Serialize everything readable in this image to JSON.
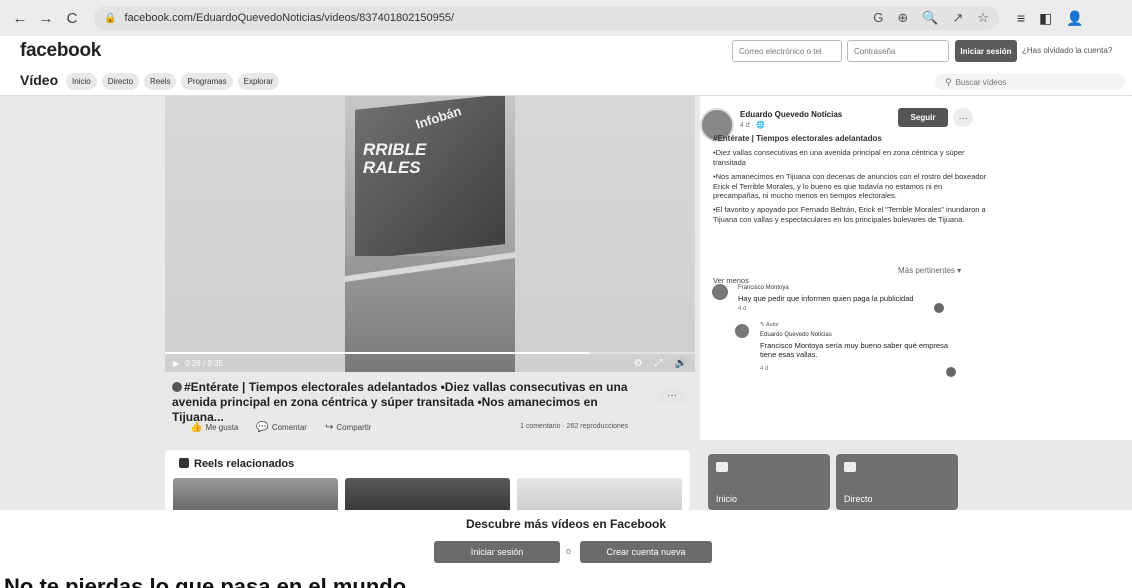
{
  "browser": {
    "url": "facebook.com/EduardoQuevedoNoticias/videos/837401802150955/"
  },
  "header": {
    "logo": "facebook",
    "email_placeholder": "Correo electrónico o tel",
    "password_placeholder": "Contraseña",
    "login_label": "Iniciar sesión",
    "forgot_label": "¿Has olvidado la cuenta?"
  },
  "video_nav": {
    "title": "Vídeo",
    "pills": [
      "Inicio",
      "Directo",
      "Reels",
      "Programas",
      "Explorar"
    ],
    "search_placeholder": "Buscar vídeos"
  },
  "video": {
    "billboard_text": "RRIBLE\nRALES",
    "billboard_brand": "Infobán",
    "time": "0:28 / 0:35",
    "progress": 0.8
  },
  "post": {
    "caption": "#Entérate | Tiempos electorales adelantados •Diez vallas consecutivas en una avenida principal en zona céntrica y súper transitada •Nos amanecimos en Tijuana...",
    "actions": [
      "Me gusta",
      "Comentar",
      "Compartir"
    ],
    "stats": "1 comentario · 262 reproducciones"
  },
  "sidebar": {
    "author": "Eduardo Quevedo Noticias",
    "meta": "4 d · ",
    "follow_label": "Seguir",
    "headline": "#Entérate | Tiempos electorales adelantados",
    "paragraphs": [
      "•Diez vallas consecutivas en una avenida principal en zona céntrica y súper transitada",
      "•Nos amanecimos en Tijuana con decenas de anuncios con el rostro del boxeador Erick el Terrible Morales, y lo bueno es que todavía no estamos ni en precampañas, ni mucho menos en tiempos electorales.",
      "•El favorito y apoyado por Fernado Beltrán, Erick el \"Terrible Morales\" inundaron a Tijuana con vallas y espectaculares en los principales bulevares de Tijuana."
    ],
    "see_less": "Ver menos",
    "relevance": "Más pertinentes ▾",
    "comments": [
      {
        "name": "Francisco Montoya",
        "text": "Hay que pedir que informen quien paga la publicidad",
        "time": "4 d"
      },
      {
        "author_tag": "Autor",
        "name": "Eduardo Quevedo Noticias",
        "text": "Francisco Montoya sería muy bueno saber qué empresa tiene esas vallas.",
        "time": "4 d"
      }
    ]
  },
  "reels": {
    "title": "Reels relacionados"
  },
  "tiles": [
    {
      "label": "Inicio"
    },
    {
      "label": "Directo"
    }
  ],
  "cta": {
    "text": "Descubre más vídeos en Facebook",
    "login_label": "Iniciar sesión",
    "or_label": "o",
    "create_label": "Crear cuenta nueva"
  },
  "cut_text": "No te pierdas lo que pasa en el mundo"
}
